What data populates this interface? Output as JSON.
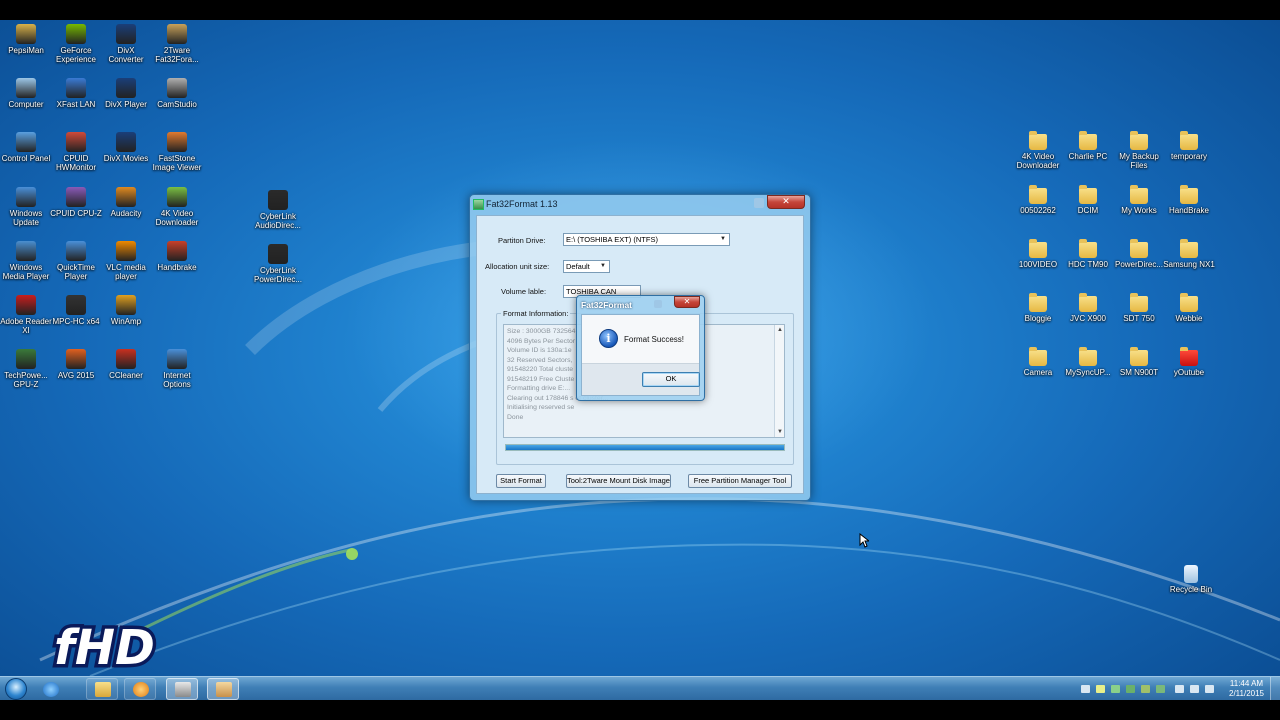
{
  "desktop": {
    "icons_left": [
      {
        "label": "PepsiMan",
        "kind": "app",
        "color": "#d9b24a"
      },
      {
        "label": "GeForce Experience",
        "kind": "app",
        "color": "#76b900"
      },
      {
        "label": "DivX Converter",
        "kind": "app",
        "color": "#1a3f7a"
      },
      {
        "label": "2Tware Fat32Fora...",
        "kind": "app",
        "color": "#c8a25a"
      },
      {
        "label": "Computer",
        "kind": "app",
        "color": "#9cc7e8"
      },
      {
        "label": "XFast LAN",
        "kind": "app",
        "color": "#3a7bd5"
      },
      {
        "label": "DivX Player",
        "kind": "app",
        "color": "#1a3f7a"
      },
      {
        "label": "CamStudio",
        "kind": "app",
        "color": "#b0b0b0"
      },
      {
        "label": "Control Panel",
        "kind": "app",
        "color": "#5aa0e0"
      },
      {
        "label": "CPUID HWMonitor",
        "kind": "app",
        "color": "#d04a3a"
      },
      {
        "label": "DivX Movies",
        "kind": "app",
        "color": "#1a3f7a"
      },
      {
        "label": "FastStone Image Viewer",
        "kind": "app",
        "color": "#e07a30"
      },
      {
        "label": "Windows Update",
        "kind": "app",
        "color": "#4a90d9"
      },
      {
        "label": "CPUID CPU-Z",
        "kind": "app",
        "color": "#8a5ab8"
      },
      {
        "label": "Audacity",
        "kind": "app",
        "color": "#e08a20"
      },
      {
        "label": "4K Video Downloader",
        "kind": "app",
        "color": "#7ac043"
      },
      {
        "label": "CyberLink AudioDirec...",
        "kind": "app",
        "color": "#2a2a2a"
      },
      {
        "label": "Windows Media Player",
        "kind": "app",
        "color": "#4a8fd0"
      },
      {
        "label": "QuickTime Player",
        "kind": "app",
        "color": "#4a90d9"
      },
      {
        "label": "VLC media player",
        "kind": "app",
        "color": "#f08a00"
      },
      {
        "label": "Handbrake",
        "kind": "app",
        "color": "#c8402a"
      },
      {
        "label": "CyberLink PowerDirec...",
        "kind": "app",
        "color": "#2a2a2a"
      },
      {
        "label": "Adobe Reader XI",
        "kind": "app",
        "color": "#c81e1e"
      },
      {
        "label": "MPC-HC x64",
        "kind": "app",
        "color": "#333333"
      },
      {
        "label": "WinAmp",
        "kind": "app",
        "color": "#e0a020"
      },
      {
        "label": "TechPowe... GPU-Z",
        "kind": "app",
        "color": "#3a7a3a"
      },
      {
        "label": "AVG 2015",
        "kind": "app",
        "color": "#e06020"
      },
      {
        "label": "CCleaner",
        "kind": "app",
        "color": "#c83020"
      },
      {
        "label": "Internet Options",
        "kind": "app",
        "color": "#4a90d9"
      }
    ],
    "icons_right": [
      {
        "label": "4K Video Downloader"
      },
      {
        "label": "Charlie PC"
      },
      {
        "label": "My Backup Files"
      },
      {
        "label": "temporary"
      },
      {
        "label": "00502262"
      },
      {
        "label": "DCIM"
      },
      {
        "label": "My Works"
      },
      {
        "label": "HandBrake"
      },
      {
        "label": "100VIDEO"
      },
      {
        "label": "HDC TM90"
      },
      {
        "label": "PowerDirec..."
      },
      {
        "label": "Samsung NX1"
      },
      {
        "label": "Bloggie"
      },
      {
        "label": "JVC X900"
      },
      {
        "label": "SDT 750"
      },
      {
        "label": "Webbie"
      },
      {
        "label": "Camera"
      },
      {
        "label": "MySyncUP..."
      },
      {
        "label": "SM N900T"
      },
      {
        "label": "yOutube"
      }
    ],
    "recycle_bin": "Recycle Bin",
    "watermark": "fHD"
  },
  "main_window": {
    "title": "Fat32Format 1.13",
    "close_label": "✕",
    "partition_label": "Partiton Drive:",
    "partition_value": "E:\\  (TOSHIBA EXT)  (NTFS)",
    "alloc_label": "Allocation unit size:",
    "alloc_value": "Default",
    "volume_label": "Volume lable:",
    "volume_value": "TOSHIBA CAN",
    "format_info_label": "Format Information:",
    "log": [
      "Size : 3000GB 732564",
      "4096 Bytes Per Sector",
      "Volume ID is 130a:1e",
      "32 Reserved Sectors,",
      "91548220 Total cluste",
      "91548219 Free Cluste",
      "Formatting drive E:...",
      "Clearing out 178846 s                         ot cluster...",
      "Initialising reserved se",
      "Done"
    ],
    "progress": 1.0,
    "buttons": {
      "start": "Start Format",
      "mount": "Tool:2Tware Mount Disk Image",
      "partition": "Free Partition Manager Tool"
    }
  },
  "dialog": {
    "title": "Fat32Format",
    "close_label": "✕",
    "icon": "info-icon",
    "message": "Format Success!",
    "ok": "OK"
  },
  "taskbar": {
    "time": "11:44 AM",
    "date": "2/11/2015"
  }
}
